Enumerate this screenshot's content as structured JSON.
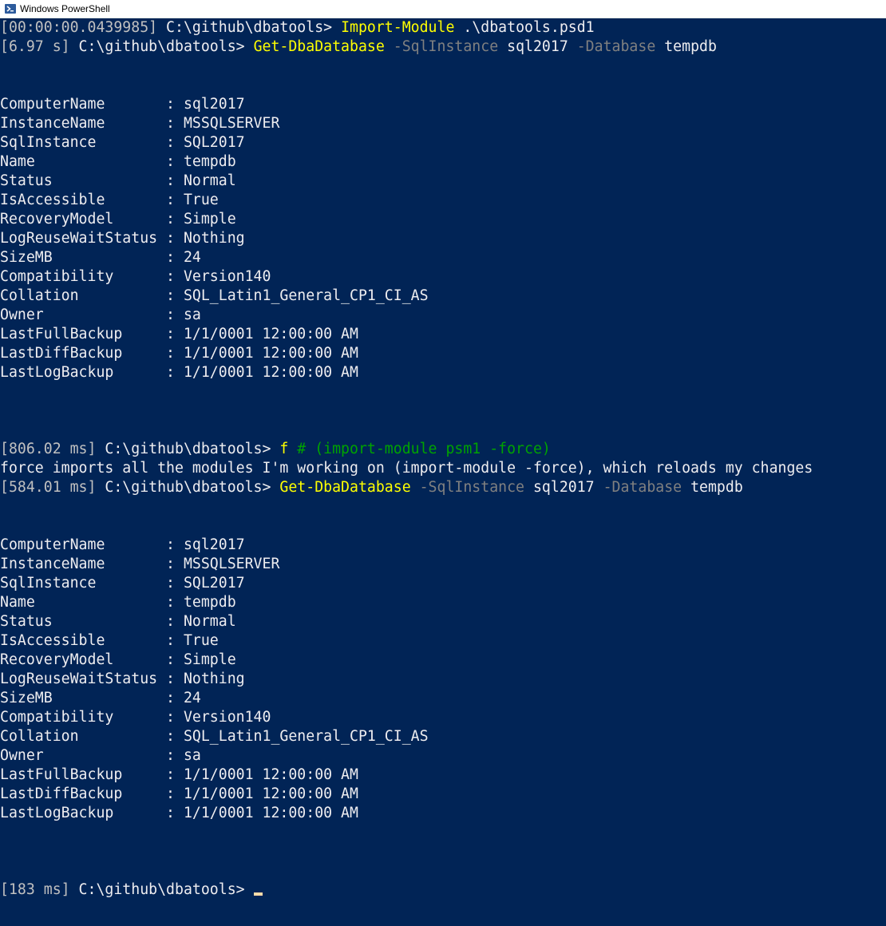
{
  "window": {
    "title": "Windows PowerShell"
  },
  "console": {
    "block1": {
      "line1": {
        "time": "[00:00:00.0439985]",
        "path": " C:\\github\\dbatools> ",
        "cmd": "Import-Module",
        "arg": " .\\dbatools.psd1"
      },
      "line2": {
        "time": "[6.97 s]",
        "path": " C:\\github\\dbatools> ",
        "cmd": "Get-DbaDatabase",
        "p1": " -SqlInstance",
        "a1": " sql2017",
        "p2": " -Database",
        "a2": " tempdb"
      },
      "props": [
        "ComputerName       : sql2017",
        "InstanceName       : MSSQLSERVER",
        "SqlInstance        : SQL2017",
        "Name               : tempdb",
        "Status             : Normal",
        "IsAccessible       : True",
        "RecoveryModel      : Simple",
        "LogReuseWaitStatus : Nothing",
        "SizeMB             : 24",
        "Compatibility      : Version140",
        "Collation          : SQL_Latin1_General_CP1_CI_AS",
        "Owner              : sa",
        "LastFullBackup     : 1/1/0001 12:00:00 AM",
        "LastDiffBackup     : 1/1/0001 12:00:00 AM",
        "LastLogBackup      : 1/1/0001 12:00:00 AM"
      ]
    },
    "block2": {
      "line1": {
        "time": "[806.02 ms]",
        "path": " C:\\github\\dbatools> ",
        "cmd": "f",
        "comment": " # (import-module psm1 -force)"
      },
      "output": "force imports all the modules I'm working on (import-module -force), which reloads my changes",
      "line2": {
        "time": "[584.01 ms]",
        "path": " C:\\github\\dbatools> ",
        "cmd": "Get-DbaDatabase",
        "p1": " -SqlInstance",
        "a1": " sql2017",
        "p2": " -Database",
        "a2": " tempdb"
      },
      "props": [
        "ComputerName       : sql2017",
        "InstanceName       : MSSQLSERVER",
        "SqlInstance        : SQL2017",
        "Name               : tempdb",
        "Status             : Normal",
        "IsAccessible       : True",
        "RecoveryModel      : Simple",
        "LogReuseWaitStatus : Nothing",
        "SizeMB             : 24",
        "Compatibility      : Version140",
        "Collation          : SQL_Latin1_General_CP1_CI_AS",
        "Owner              : sa",
        "LastFullBackup     : 1/1/0001 12:00:00 AM",
        "LastDiffBackup     : 1/1/0001 12:00:00 AM",
        "LastLogBackup      : 1/1/0001 12:00:00 AM"
      ]
    },
    "final_prompt": {
      "time": "[183 ms]",
      "path": " C:\\github\\dbatools> "
    }
  },
  "colors": {
    "background": "#012456",
    "command": "#ffff00",
    "parameter": "#808080",
    "comment": "#00a300",
    "cursor": "#fedba9"
  },
  "icons": {
    "app": "powershell-icon"
  }
}
